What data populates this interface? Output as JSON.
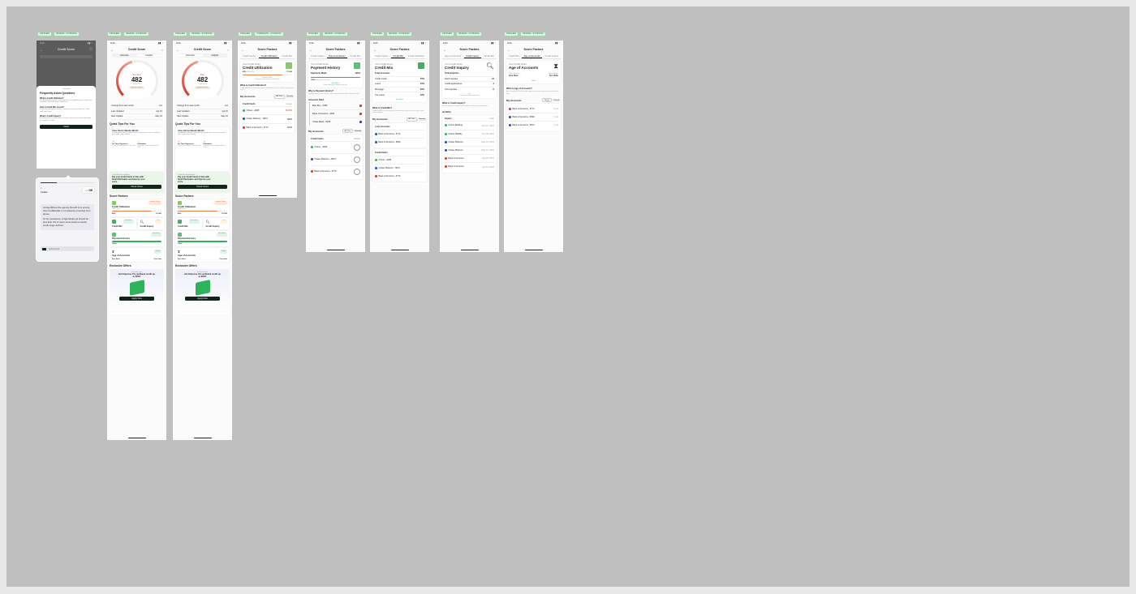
{
  "tags": [
    [
      "FINISHED",
      "REVIEW - 07/09/2023"
    ],
    [
      "FINISHED",
      "REVIEW - 07/09/2023"
    ],
    [
      "FINISHED",
      "REVIEW - 07/09/2023"
    ],
    [
      "FINISHED",
      "COMMENTS - 07/09/2023"
    ],
    [
      "FINISHED",
      "REVIEW - 07/09/2023"
    ],
    [
      "FINISHED",
      "REVIEW - 07/09/2023"
    ],
    [
      "FINISHED",
      "REVIEW - 07/09/2023"
    ],
    [
      "FINISHED",
      "REVIEW - 07/09/2023"
    ]
  ],
  "status_time": "9:41",
  "faq": {
    "header": "Credit Score",
    "title": "Frequently Asked Questions",
    "q1": "What is Credit Utilization?",
    "a1": "Credit utilization is your credit card balance divided by your credit limit. Keeping it low helps your credit score.",
    "q2": "How is Credit Mix scored?",
    "a2": "Credit mix shows the variety of credit accounts you hold, like credit cards and loans.",
    "q3": "What is Credit Inquiry?",
    "a3": "A credit inquiry is made when a lender checks your credit report after you apply for credit.",
    "close": "Close"
  },
  "tooltip": {
    "label": "Creditor",
    "value_label": "+44",
    "value": "09",
    "text1": "At AlgorMinus this agency, Benefit is to ensure that CreditEnable is consistently protected from abuse.",
    "text2": "To be considered, a high fidelity ad should be less than 4% of users score below a certain credit range defined.",
    "action": "Action Items"
  },
  "score_screen": {
    "title": "Credit Score",
    "tab1": "Overview",
    "tab2": "Insights",
    "score": "482",
    "rating_a": "Very Poor",
    "rating_b": "Poor",
    "sub": "out of 900",
    "badge": "Improve Score",
    "rows": [
      [
        "Change from last month",
        "+12"
      ],
      [
        "Last Updated",
        "Apr 16"
      ],
      [
        "Next Update",
        "May 16"
      ]
    ],
    "tips_title": "Quick Tips For You",
    "tip_heading": "Your Score Needs Work!",
    "tip_text": "Pay off your balances and make your payments on time to improve your credit score steadily.",
    "tip_items": [
      [
        "On Time Payments",
        "Pay all your bills before the due date"
      ],
      [
        "Utilization",
        "Keep your credit utilization below 30%"
      ]
    ],
    "promo_small": "Credit Recommendation",
    "promo_text": "Pay your Credit Cards in time with Smart Reminders and Improve your score",
    "promo_button": "Check Score",
    "factors_title": "Score Factors",
    "factor_cu": "Credit Utilization",
    "factor_cu_sub": "High Impact",
    "factor_cu_badge": "Needs Work",
    "factor_cu_pct": "80%",
    "factor_cu_amt": "$1,500",
    "factor_cm": "Credit Mix",
    "factor_cm_badge": "Excellent",
    "factor_ci": "Credit Inquiry",
    "factor_ci_badge": "Fair",
    "factor_ph": "Payment History",
    "factor_ph_badge": "Excellent",
    "factor_ph_pct": "100%",
    "factor_aa": "Age of Accounts",
    "factor_aa_badge": "Good",
    "factor_aa_a": "2yrs 8mo",
    "factor_aa_b": "7yrs 6mo",
    "offers_title": "Exclusive Offers",
    "offer_small": "Personal Loan",
    "offer_text": "Get Emprove 1% cashback credit up to $500!",
    "offer_button": "Apply Now",
    "score_sub2": "Credit Score"
  },
  "factors_header": "Score Factors",
  "factor_tabs": [
    "Credit Inquiry",
    "Credit Utilization",
    "Credit Mix",
    "Payment History",
    "Age of Accounts"
  ],
  "cu": {
    "title": "Credit Utilization",
    "small": "Your Credit Score",
    "pct": "80%",
    "pct_label": "utilization",
    "amt": "$1,500",
    "note": "Needs Work",
    "note_sub": "Keep your credit utilization below 30%",
    "what": "What is Credit Utilization?",
    "what_text": "Credit utilization is the portion of your credit limit you are currently using across cards.",
    "accounts": "My Accounts",
    "filter_a": "All Time",
    "filter_b": "Monthly",
    "list_title": "Credit Cards",
    "list_right": "Usage",
    "items": [
      [
        "Chime - 4438",
        "$1,560"
      ],
      [
        "Chase Platinum - 5872",
        "$820"
      ],
      [
        "Bank of America - 6774",
        "$120"
      ]
    ]
  },
  "ph": {
    "title": "Payment History",
    "small": "Your Credit Score",
    "label": "Payments Made",
    "value": "12/12",
    "pct": "100%",
    "pct_label": "payments on time",
    "note": "Excellent",
    "note_sub": "Keep making your payments on time",
    "what": "Why is Payment History?",
    "what_text": "Payment history tracks whether you have paid past credit accounts on time.",
    "recent": "Amounts Paid",
    "paid": [
      [
        "Best Buy - 5456",
        "$49"
      ],
      [
        "Bank of America - 4430",
        "$49"
      ],
      [
        "Chase Bank - 5456",
        "$49"
      ]
    ],
    "accounts": "My Accounts",
    "filter_a": "All Time",
    "filter_b": "Monthly",
    "list_title": "Credit Cards",
    "list_right": "Details",
    "items": [
      [
        "Chime - 4438",
        "$460"
      ],
      [
        "Chase Platinum - 5872",
        "$320"
      ],
      [
        "Bank of America - 6774",
        "$180"
      ]
    ]
  },
  "cm": {
    "title": "Credit Mix",
    "small": "Your Credit Score",
    "label": "Total Accounts",
    "rows": [
      [
        "Credit Cards",
        "75%"
      ],
      [
        "Loans",
        "40%"
      ],
      [
        "Mortgage",
        "20%"
      ],
      [
        "Car Loans",
        "12%"
      ]
    ],
    "note": "Excellent",
    "what": "What is Credit Mix?",
    "what_text": "Credit mix refers to the variety of credit accounts you have, like cards, loans and mortgages.",
    "accounts": "My Accounts",
    "filter_a": "All Time",
    "filter_b": "Monthly",
    "group1": "Loan Accounts",
    "g1": [
      [
        "Bank of America - 6774",
        "$2,400"
      ],
      [
        "Bank of America - 6699",
        "$1,200"
      ]
    ],
    "group2": "Credit Cards",
    "g2": [
      [
        "Chime - 4438",
        "$460"
      ],
      [
        "Chase Platinum - 5872",
        "$320"
      ],
      [
        "Bank of America - 6774",
        "$180"
      ]
    ]
  },
  "ci": {
    "title": "Credit Inquiry",
    "small": "Your Credit Score",
    "label": "Total Inquiries",
    "rows": [
      [
        "Hard Inquiries",
        "12"
      ],
      [
        "Credit Applications",
        "4"
      ],
      [
        "Soft Inquiries",
        "8"
      ]
    ],
    "note": "Fair",
    "note_sub": "Keep your credit inquiries low",
    "what": "What is Credit Inquiry?",
    "what_text": "A credit inquiry is a request by a lender to review your credit report.",
    "activity": "Activity",
    "inquiry": "Inquiry",
    "inquiry_right": "Date",
    "items": [
      [
        "Chime Banking",
        "Jun 12, 2023"
      ],
      [
        "Chime Mobility",
        "Jun 08, 2023"
      ],
      [
        "Chase Platinum",
        "May 22, 2023"
      ],
      [
        "Chase Platinum",
        "May 10, 2023"
      ],
      [
        "Bank of America",
        "Apr 28, 2023"
      ],
      [
        "Bank of America",
        "Apr 12, 2023"
      ]
    ]
  },
  "aa": {
    "title": "Age of Accounts",
    "small": "Your Credit Score",
    "oldest_label": "Oldest Account",
    "oldest": "2yrs 8mo",
    "avg_label": "Average Age",
    "avg": "7yrs 6mo",
    "note": "Good",
    "what": "What is Age of Accounts?",
    "what_text": "Age of accounts is the average length of time your credit accounts have been open.",
    "accounts": "My Accounts",
    "filter_a": "Active",
    "filter_b": "Closed",
    "items": [
      [
        "Bank of America - 6774",
        "5 yrs"
      ],
      [
        "Bank of America - 6699",
        "3 yrs"
      ],
      [
        "Bank of America - 5874",
        "2 yrs"
      ]
    ]
  },
  "colors": {
    "accent": "#13231a",
    "green": "#2fb35a",
    "red": "#d9352a",
    "orange": "#e7824a"
  }
}
